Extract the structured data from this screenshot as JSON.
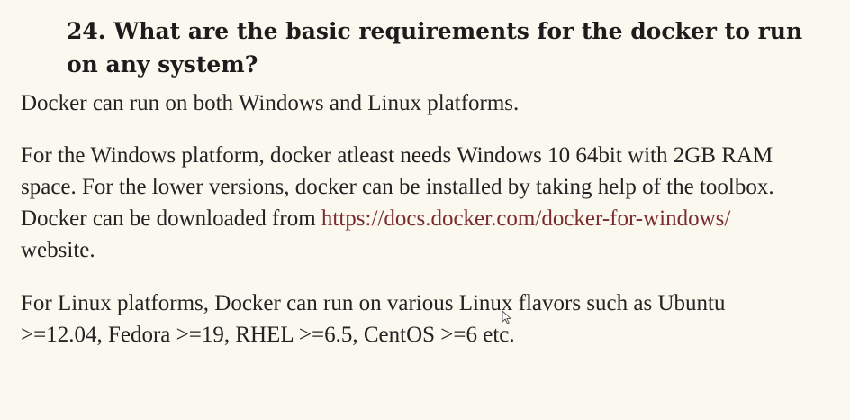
{
  "question": {
    "heading": "24. What are the basic requirements for the docker to run on any system?"
  },
  "paragraphs": {
    "intro": "Docker can run on both Windows and Linux platforms.",
    "windows": {
      "line1": "For the Windows platform, docker atleast needs Windows 10 64bit with 2GB RAM",
      "line2": "space. For the lower versions, docker can be installed by taking help of the toolbox.",
      "line3_prefix": "Docker can be downloaded from ",
      "link_text": "https://docs.docker.com/docker-for-windows/",
      "line4": "website."
    },
    "linux": {
      "line1": "For Linux platforms, Docker can run on various Linux flavors such as Ubuntu",
      "line2": ">=12.04, Fedora >=19, RHEL >=6.5, CentOS >=6 etc."
    }
  },
  "colors": {
    "background": "#fbf8ef",
    "text": "#232323",
    "link": "#7b2d2d"
  },
  "icons": {
    "cursor": "mouse-pointer-icon"
  }
}
